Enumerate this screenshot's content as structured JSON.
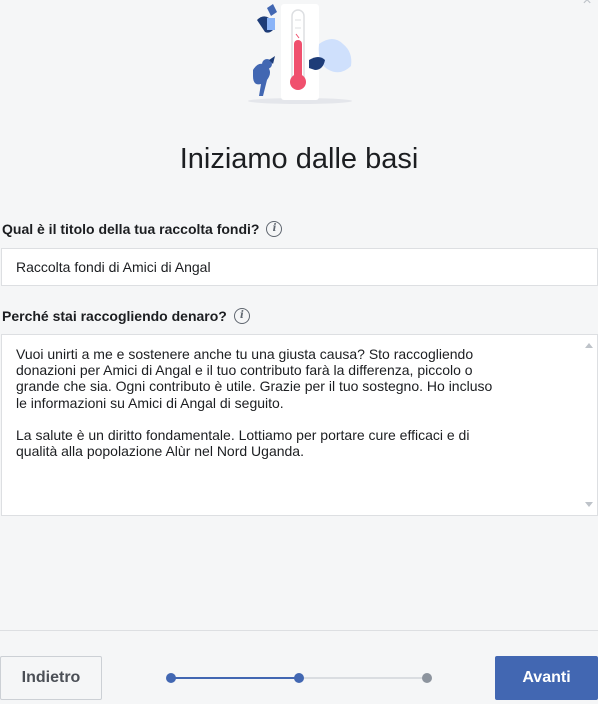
{
  "dialog": {
    "title": "Iniziamo dalle basi"
  },
  "fields": {
    "fundraiser_title": {
      "label": "Qual è il titolo della tua raccolta fondi?",
      "value": "Raccolta fondi di Amici di Angal"
    },
    "reason": {
      "label": "Perché stai raccogliendo denaro?",
      "value": "Vuoi unirti a me e sostenere anche tu una giusta causa? Sto raccogliendo\ndonazioni per Amici di Angal e il tuo contributo farà la differenza, piccolo o\ngrande che sia. Ogni contributo è utile. Grazie per il tuo sostegno. Ho incluso\nle informazioni su Amici di Angal di seguito.\n\nLa salute è un diritto fondamentale. Lottiamo per portare cure efficaci e di\nqualità alla popolazione Alùr nel Nord Uganda."
    }
  },
  "footer": {
    "back_label": "Indietro",
    "next_label": "Avanti",
    "progress": {
      "current_step": 2,
      "total_steps": 3
    }
  },
  "icons": {
    "info": "info-icon",
    "close": "close-icon",
    "illustration": "thermometer-illustration"
  },
  "colors": {
    "primary": "#4267b2",
    "background": "#f5f6f7",
    "thermometer": "#f0506e"
  }
}
